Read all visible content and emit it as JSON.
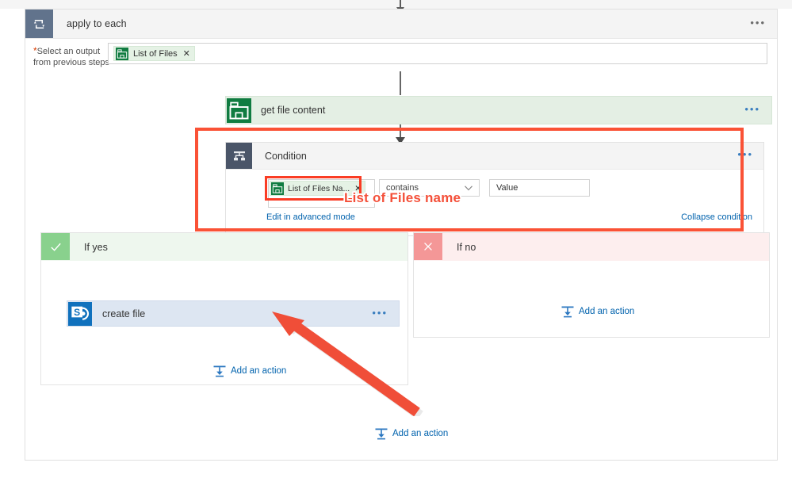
{
  "flow": {
    "apply_to_each": {
      "title": "apply to each",
      "icon": "loop-icon",
      "menu": "•••",
      "select_output_label_line1": "Select an output",
      "select_output_label_line2": "from previous steps",
      "required_marker": "*",
      "token_chip": {
        "icon": "onedrive-folder-icon",
        "label": "List of Files",
        "remove": "✕"
      }
    },
    "get_file_content": {
      "title": "get file content",
      "icon": "onedrive-folder-icon",
      "menu": "•••"
    },
    "condition": {
      "title": "Condition",
      "icon": "condition-fork-icon",
      "menu": "•••",
      "left_token": {
        "icon": "onedrive-folder-icon",
        "label": "List of Files Na...",
        "remove": "✕"
      },
      "operator": "contains",
      "operator_chevron": "chevron-down-icon",
      "value_placeholder": "Value",
      "advanced_link": "Edit in advanced mode",
      "collapse_link": "Collapse condition"
    },
    "branch_yes": {
      "label": "If yes",
      "status_icon": "check-icon",
      "action": {
        "title": "create file",
        "icon": "sharepoint-icon",
        "menu": "•••"
      },
      "add_action": "Add an action",
      "add_action_icon": "insert-action-icon"
    },
    "branch_no": {
      "label": "If no",
      "status_icon": "close-icon",
      "add_action": "Add an action",
      "add_action_icon": "insert-action-icon"
    },
    "bottom_add_action": {
      "label": "Add an action",
      "icon": "insert-action-icon"
    }
  },
  "annotations": {
    "callout_text": "List of Files name",
    "callout_color": "#f4503a",
    "highlight_color": "#fa5236",
    "arrow_color": "#f04e38"
  }
}
